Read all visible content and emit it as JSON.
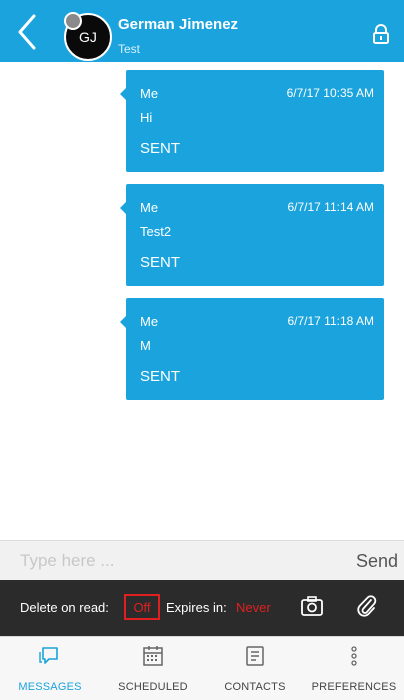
{
  "header": {
    "contact_name": "German Jimenez",
    "contact_status": "Test",
    "avatar_initials": "GJ",
    "accent_color": "#1aa3dc"
  },
  "messages": [
    {
      "sender": "Me",
      "timestamp": "6/7/17 10:35 AM",
      "text": "Hi",
      "status": "SENT"
    },
    {
      "sender": "Me",
      "timestamp": "6/7/17 11:14 AM",
      "text": "Test2",
      "status": "SENT"
    },
    {
      "sender": "Me",
      "timestamp": "6/7/17 11:18 AM",
      "text": "M",
      "status": "SENT"
    }
  ],
  "composer": {
    "placeholder": "Type here ...",
    "value": "",
    "send_label": "Send"
  },
  "options": {
    "delete_on_read_label": "Delete on read:",
    "delete_on_read_value": "Off",
    "expires_label": "Expires in:",
    "expires_value": "Never"
  },
  "nav": {
    "items": [
      {
        "label": "MESSAGES",
        "icon": "messages-icon",
        "active": true
      },
      {
        "label": "SCHEDULED",
        "icon": "calendar-icon",
        "active": false
      },
      {
        "label": "CONTACTS",
        "icon": "contacts-icon",
        "active": false
      },
      {
        "label": "PREFERENCES",
        "icon": "more-vertical-icon",
        "active": false
      }
    ]
  }
}
